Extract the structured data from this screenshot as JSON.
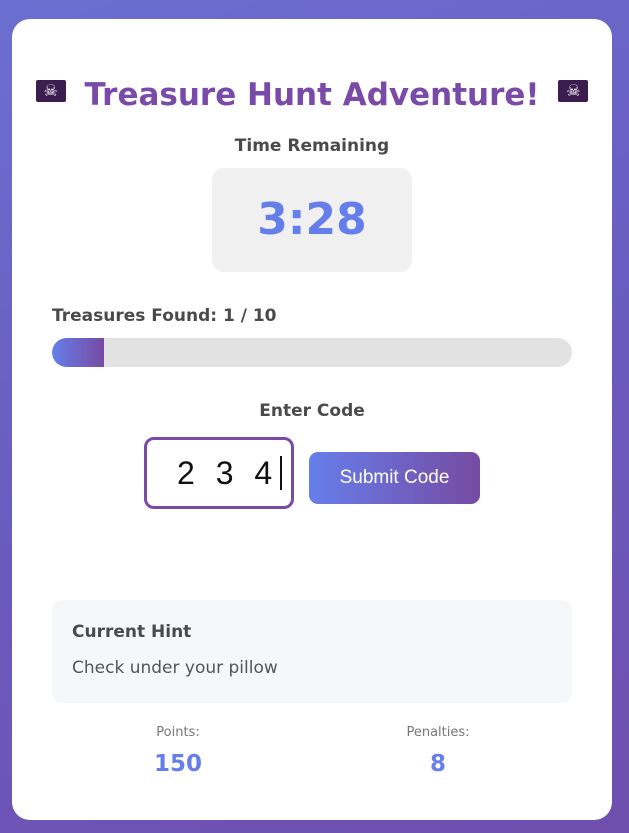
{
  "header": {
    "title": "Treasure Hunt Adventure!",
    "left_icon": "pirate-flag-icon",
    "right_icon": "pirate-flag-icon"
  },
  "timer": {
    "label": "Time Remaining",
    "value": "3:28"
  },
  "progress": {
    "label": "Treasures Found: 1 / 10",
    "found": 1,
    "total": 10,
    "fraction": 0.1
  },
  "code_entry": {
    "label": "Enter Code",
    "value": "234",
    "submit_label": "Submit Code"
  },
  "hint": {
    "title": "Current Hint",
    "text": "Check under your pillow"
  },
  "stats": {
    "points_label": "Points:",
    "points_value": "150",
    "penalties_label": "Penalties:",
    "penalties_value": "8"
  },
  "colors": {
    "accent": "#667eea",
    "accent_end": "#764ba2",
    "title": "#7a4aa8"
  }
}
